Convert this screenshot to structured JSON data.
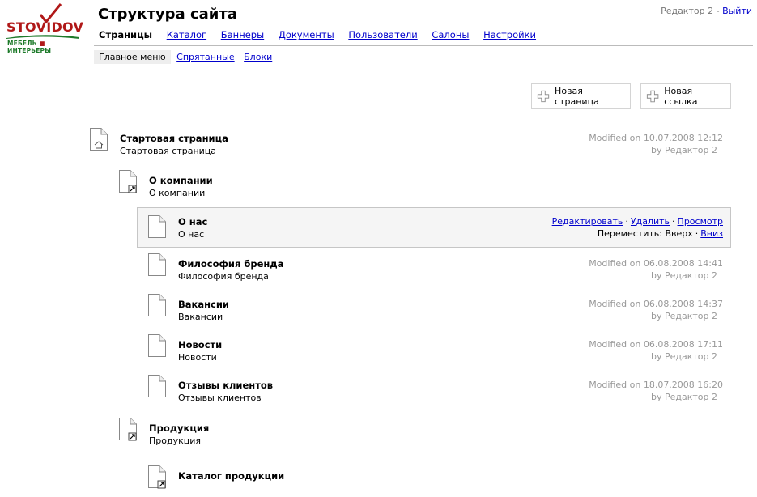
{
  "logo": {
    "brand": "STOVIDOV",
    "tagline_left": "МЕБЕЛЬ",
    "tagline_right": "ИНТЕРЬЕРЫ"
  },
  "header": {
    "title": "Структура сайта",
    "user": "Редактор 2",
    "user_separator": "-",
    "logout": "Выйти"
  },
  "main_nav": [
    {
      "label": "Страницы",
      "active": true
    },
    {
      "label": "Каталог"
    },
    {
      "label": "Баннеры"
    },
    {
      "label": "Документы"
    },
    {
      "label": "Пользователи"
    },
    {
      "label": "Салоны"
    },
    {
      "label": "Настройки"
    }
  ],
  "sub_nav": [
    {
      "label": "Главное меню",
      "active": true
    },
    {
      "label": "Спрятанные"
    },
    {
      "label": "Блоки"
    }
  ],
  "buttons": {
    "new_page": "Новая страница",
    "new_link": "Новая ссылка"
  },
  "actions": {
    "edit": "Редактировать",
    "delete": "Удалить",
    "view": "Просмотр",
    "move": "Переместить:",
    "up": "Вверх",
    "down": "Вниз",
    "separator": "·"
  },
  "tree": [
    {
      "title": "Стартовая страница",
      "subtitle": "Стартовая страница",
      "icon": "home-page-icon",
      "modified": "Modified on 10.07.2008 12:12",
      "by": "by Редактор 2"
    },
    {
      "title": "О компании",
      "subtitle": "О компании",
      "icon": "link-page-icon"
    },
    {
      "title": "О нас",
      "subtitle": "О нас",
      "icon": "page-icon"
    },
    {
      "title": "Философия бренда",
      "subtitle": "Философия бренда",
      "icon": "page-icon",
      "modified": "Modified on 06.08.2008 14:41",
      "by": "by Редактор 2"
    },
    {
      "title": "Вакансии",
      "subtitle": "Вакансии",
      "icon": "page-icon",
      "modified": "Modified on 06.08.2008 14:37",
      "by": "by Редактор 2"
    },
    {
      "title": "Новости",
      "subtitle": "Новости",
      "icon": "page-icon",
      "modified": "Modified on 06.08.2008 17:11",
      "by": "by Редактор 2"
    },
    {
      "title": "Отзывы клиентов",
      "subtitle": "Отзывы клиентов",
      "icon": "page-icon",
      "modified": "Modified on 18.07.2008 16:20",
      "by": "by Редактор 2"
    },
    {
      "title": "Продукция",
      "subtitle": "Продукция",
      "icon": "link-page-icon"
    },
    {
      "title": "Каталог продукции",
      "icon": "link-page-icon"
    }
  ],
  "colors": {
    "link": "#0000cc",
    "logo_red": "#b01818",
    "logo_green": "#1d7a2a",
    "meta_gray": "#999999",
    "hover_bg": "#f5f5f5"
  }
}
